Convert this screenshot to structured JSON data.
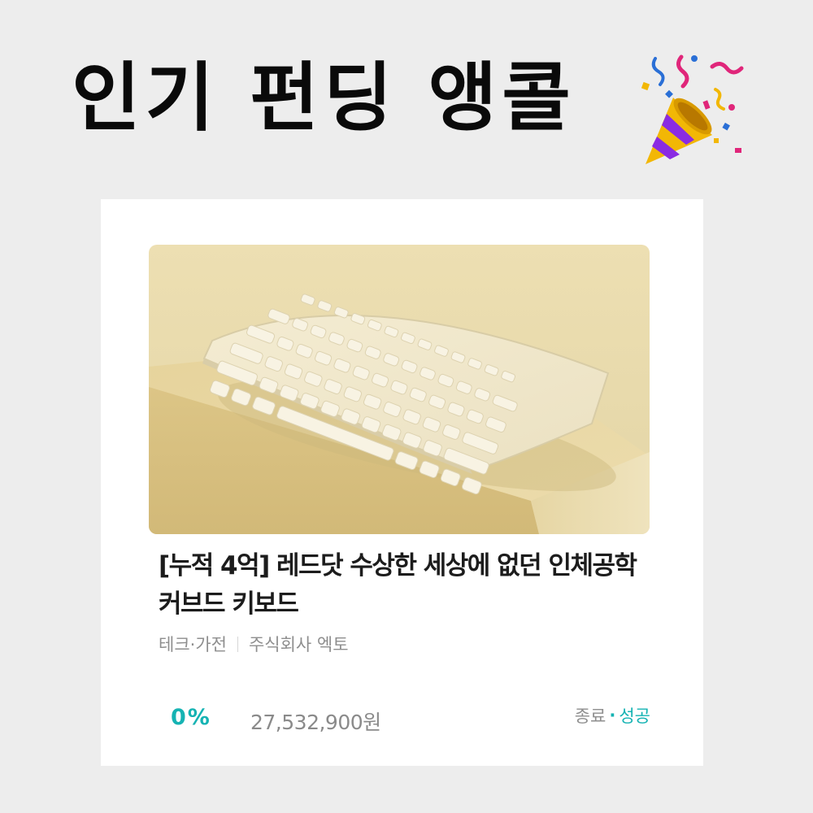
{
  "banner": {
    "headline": "인기 펀딩 앵콜",
    "icon": "party-popper-icon"
  },
  "project": {
    "image": "ergonomic-curved-keyboard-photo",
    "title": "[누적 4억] 레드닷 수상한 세상에 없던 인체공학 커브드 키보드",
    "category": "테크·가전",
    "maker": "주식회사 엑토",
    "percent": "0%",
    "amount": "27,532,900원",
    "status_ended": "종료",
    "status_separator": "·",
    "status_result": "성공"
  },
  "colors": {
    "accent": "#15b3b3",
    "background": "#ededed",
    "card": "#ffffff",
    "photo_backdrop": "#e8ddb3"
  }
}
